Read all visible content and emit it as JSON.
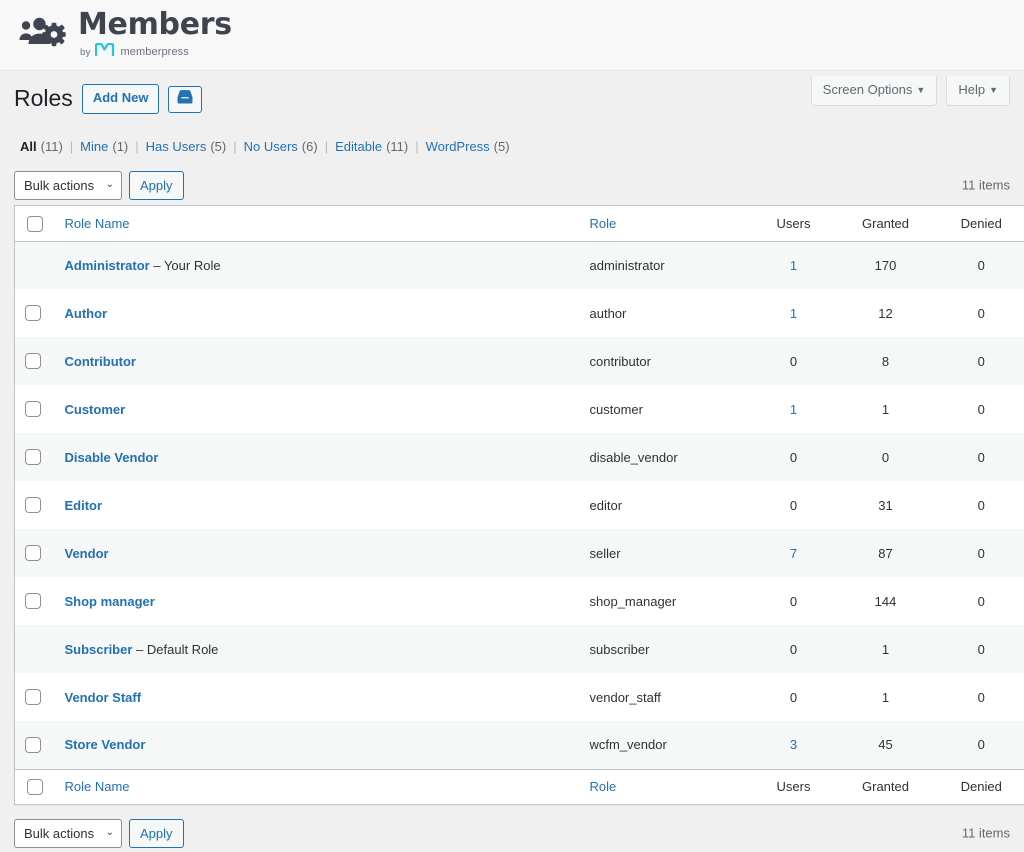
{
  "brand": {
    "logo_icon": "members-people-gear-icon",
    "title": "Members",
    "by_label": "by",
    "mp_logo_icon": "memberpress-m-icon",
    "mp_name": "memberpress"
  },
  "screen_meta": {
    "screen_options_label": "Screen Options",
    "help_label": "Help",
    "caret_glyph": "▼"
  },
  "header": {
    "page_title": "Roles",
    "add_new_label": "Add New",
    "import_icon": "inbox-tray-icon"
  },
  "filters": {
    "items": [
      {
        "label": "All",
        "count": "(11)",
        "current": true
      },
      {
        "label": "Mine",
        "count": "(1)",
        "current": false
      },
      {
        "label": "Has Users",
        "count": "(5)",
        "current": false
      },
      {
        "label": "No Users",
        "count": "(6)",
        "current": false
      },
      {
        "label": "Editable",
        "count": "(11)",
        "current": false
      },
      {
        "label": "WordPress",
        "count": "(5)",
        "current": false
      }
    ],
    "separator": "|"
  },
  "tablenav_top": {
    "bulk_actions_label": "Bulk actions",
    "chevron_glyph": "⌄",
    "apply_label": "Apply",
    "displaying_num": "11 items"
  },
  "tablenav_bottom": {
    "bulk_actions_label": "Bulk actions",
    "chevron_glyph": "⌄",
    "apply_label": "Apply",
    "displaying_num": "11 items"
  },
  "table": {
    "columns": {
      "role_name": "Role Name",
      "role": "Role",
      "users": "Users",
      "granted": "Granted",
      "denied": "Denied"
    },
    "rows": [
      {
        "name": "Administrator",
        "note": "– Your Role",
        "slug": "administrator",
        "users": "1",
        "users_link": true,
        "granted": "170",
        "denied": "0",
        "checkbox": false
      },
      {
        "name": "Author",
        "note": "",
        "slug": "author",
        "users": "1",
        "users_link": true,
        "granted": "12",
        "denied": "0",
        "checkbox": true
      },
      {
        "name": "Contributor",
        "note": "",
        "slug": "contributor",
        "users": "0",
        "users_link": false,
        "granted": "8",
        "denied": "0",
        "checkbox": true
      },
      {
        "name": "Customer",
        "note": "",
        "slug": "customer",
        "users": "1",
        "users_link": true,
        "granted": "1",
        "denied": "0",
        "checkbox": true
      },
      {
        "name": "Disable Vendor",
        "note": "",
        "slug": "disable_vendor",
        "users": "0",
        "users_link": false,
        "granted": "0",
        "denied": "0",
        "checkbox": true
      },
      {
        "name": "Editor",
        "note": "",
        "slug": "editor",
        "users": "0",
        "users_link": false,
        "granted": "31",
        "denied": "0",
        "checkbox": true
      },
      {
        "name": "Vendor",
        "note": "",
        "slug": "seller",
        "users": "7",
        "users_link": true,
        "granted": "87",
        "denied": "0",
        "checkbox": true
      },
      {
        "name": "Shop manager",
        "note": "",
        "slug": "shop_manager",
        "users": "0",
        "users_link": false,
        "granted": "144",
        "denied": "0",
        "checkbox": true
      },
      {
        "name": "Subscriber",
        "note": "– Default Role",
        "slug": "subscriber",
        "users": "0",
        "users_link": false,
        "granted": "1",
        "denied": "0",
        "checkbox": false
      },
      {
        "name": "Vendor Staff",
        "note": "",
        "slug": "vendor_staff",
        "users": "0",
        "users_link": false,
        "granted": "1",
        "denied": "0",
        "checkbox": true
      },
      {
        "name": "Store Vendor",
        "note": "",
        "slug": "wcfm_vendor",
        "users": "3",
        "users_link": true,
        "granted": "45",
        "denied": "0",
        "checkbox": true
      }
    ]
  },
  "colors": {
    "link": "#2271b1",
    "page_bg": "#f0f0f1",
    "row_alt": "#f6f7f7",
    "text": "#2c3338",
    "brand_dark": "#3f4450",
    "memberpress_teal": "#26c6da"
  }
}
